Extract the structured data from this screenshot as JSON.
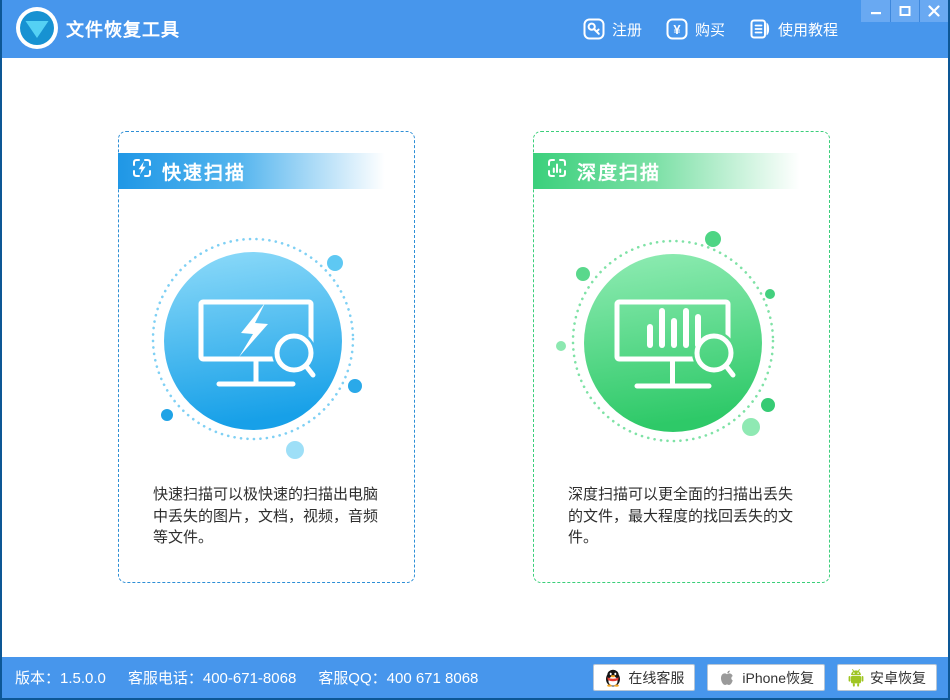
{
  "app": {
    "title": "文件恢复工具"
  },
  "titlebar": {
    "register_label": "注册",
    "buy_label": "购买",
    "buy_icon_glyph": "¥",
    "tutorial_label": "使用教程"
  },
  "cards": [
    {
      "title": "快速扫描",
      "description": "快速扫描可以极快速的扫描出电脑中丢失的图片，文档，视频，音频等文件。",
      "icon": "lightning-scan-icon",
      "accent_color": "#1f9ce8"
    },
    {
      "title": "深度扫描",
      "description": "深度扫描可以更全面的扫描出丢失的文件，最大程度的找回丢失的文件。",
      "icon": "deep-scan-bars-icon",
      "accent_color": "#3bd07c"
    }
  ],
  "footer": {
    "version": "版本：1.5.0.0",
    "phone": "客服电话：400-671-8068",
    "qq": "客服QQ：400 671 8068",
    "buttons": [
      {
        "label": "在线客服",
        "icon": "qq-penguin-icon"
      },
      {
        "label": "iPhone恢复",
        "icon": "apple-icon"
      },
      {
        "label": "安卓恢复",
        "icon": "android-icon"
      }
    ]
  },
  "colors": {
    "titlebar": "#4796ec",
    "window_border": "#0d5795",
    "card_blue_accent": "#1f9ce8",
    "card_green_accent": "#3bd07c"
  }
}
